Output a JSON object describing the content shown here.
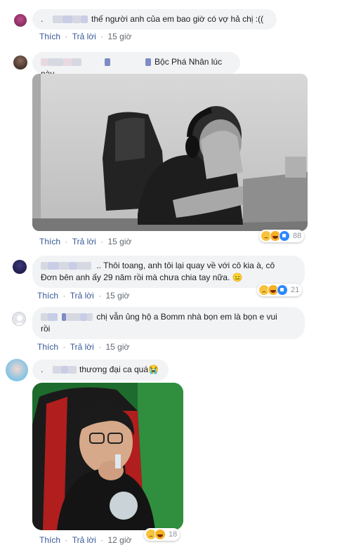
{
  "labels": {
    "like": "Thích",
    "reply": "Trả lời",
    "separator": "·"
  },
  "comments": [
    {
      "text": "thế người anh của em bao giờ có vợ hả chị :((",
      "time": "15 giờ"
    },
    {
      "text": "Bộc Phá Nhân lúc này",
      "time": "15 giờ",
      "reaction_count": "88"
    },
    {
      "text_line1": "Thôi toang, anh tôi lại quay về với cô kia à, cô",
      "text_line2": "Đơn bên anh ấy 29 năm rồi mà chưa chia tay nữa. 😑",
      "time": "15 giờ",
      "reaction_count": "21"
    },
    {
      "text_line1": "chị vẫn ủng hộ a Bomm nhà bọn em là bọn e vui",
      "text_line2": "rồi",
      "time": "15 giờ"
    },
    {
      "text": "thương đại ca quá😭",
      "time": "12 giờ",
      "reaction_count": "18"
    }
  ],
  "colors": {
    "bubble": "#f2f3f5",
    "link": "#385898",
    "meta": "#90949c"
  }
}
